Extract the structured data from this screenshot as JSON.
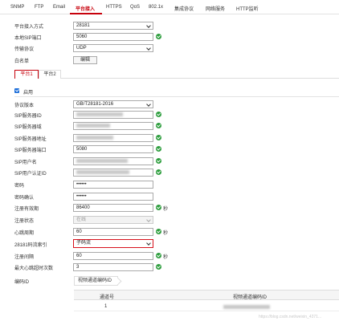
{
  "tabs": [
    "SNMP",
    "FTP",
    "Email",
    "平台接入",
    "HTTPS",
    "QoS",
    "802.1x",
    "集成协议",
    "网络服务",
    "HTTP监听"
  ],
  "top_form": {
    "platform_mode_label": "平台接入方式",
    "platform_mode_value": "28181",
    "local_sip_port_label": "本地SIP端口",
    "local_sip_port_value": "5060",
    "transport_label": "传输协议",
    "transport_value": "UDP",
    "whitelist_label": "白名单",
    "edit_button": "编辑"
  },
  "platform_tabs": [
    "平台1",
    "平台2"
  ],
  "enable_label": "启用",
  "form": {
    "protocol_version_label": "协议版本",
    "protocol_version_value": "GB/T28181-2016",
    "sip_server_id_label": "SIP服务器ID",
    "sip_server_domain_label": "SIP服务器域",
    "sip_server_address_label": "SIP服务器地址",
    "sip_server_port_label": "SIP服务器端口",
    "sip_server_port_value": "5080",
    "sip_username_label": "SIP用户名",
    "sip_auth_id_label": "SIP用户认证ID",
    "password_label": "密码",
    "password_value": "••••••",
    "password_confirm_label": "密码确认",
    "password_confirm_value": "••••••",
    "reg_validity_label": "注册有效期",
    "reg_validity_value": "86400",
    "reg_validity_unit": "秒",
    "reg_status_label": "注册状态",
    "reg_status_value": "在线",
    "heartbeat_label": "心跳周期",
    "heartbeat_value": "60",
    "heartbeat_unit": "秒",
    "stream_index_label": "28181码流索引",
    "stream_index_value": "子码流",
    "reg_interval_label": "注册间隔",
    "reg_interval_value": "60",
    "reg_interval_unit": "秒",
    "max_heartbeat_timeout_label": "最大心跳超时次数",
    "max_heartbeat_timeout_value": "3",
    "encode_id_label": "编码ID"
  },
  "encode_id": {
    "subtab": "视频通道编码ID",
    "columns": [
      "通道号",
      "视频通道编码ID"
    ],
    "rows": [
      {
        "channel": "1"
      }
    ]
  },
  "watermark": "https://blog.csdn.net/weixin_4371..."
}
